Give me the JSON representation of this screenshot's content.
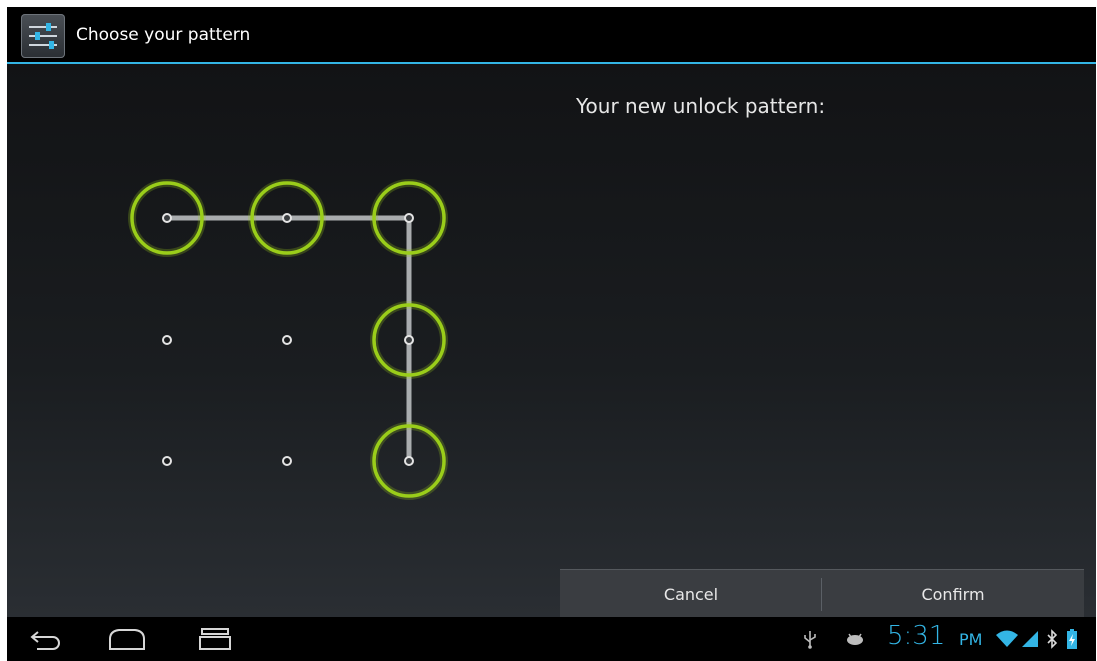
{
  "action_bar": {
    "title": "Choose your pattern",
    "icon": "settings-sliders-icon"
  },
  "main": {
    "prompt": "Your new unlock pattern:",
    "pattern": {
      "selected_dots": [
        0,
        1,
        2,
        5,
        8
      ],
      "accent": "#9acd1a"
    }
  },
  "buttons": {
    "cancel": "Cancel",
    "confirm": "Confirm"
  },
  "status_bar": {
    "time": "5:31",
    "ampm": "PM",
    "icons": [
      "usb-icon",
      "android-debug-icon",
      "wifi-icon",
      "signal-icon",
      "bluetooth-icon",
      "battery-charging-icon"
    ],
    "accent": "#33b5e5"
  },
  "nav": {
    "icons": [
      "back-icon",
      "home-icon",
      "recent-apps-icon"
    ]
  }
}
